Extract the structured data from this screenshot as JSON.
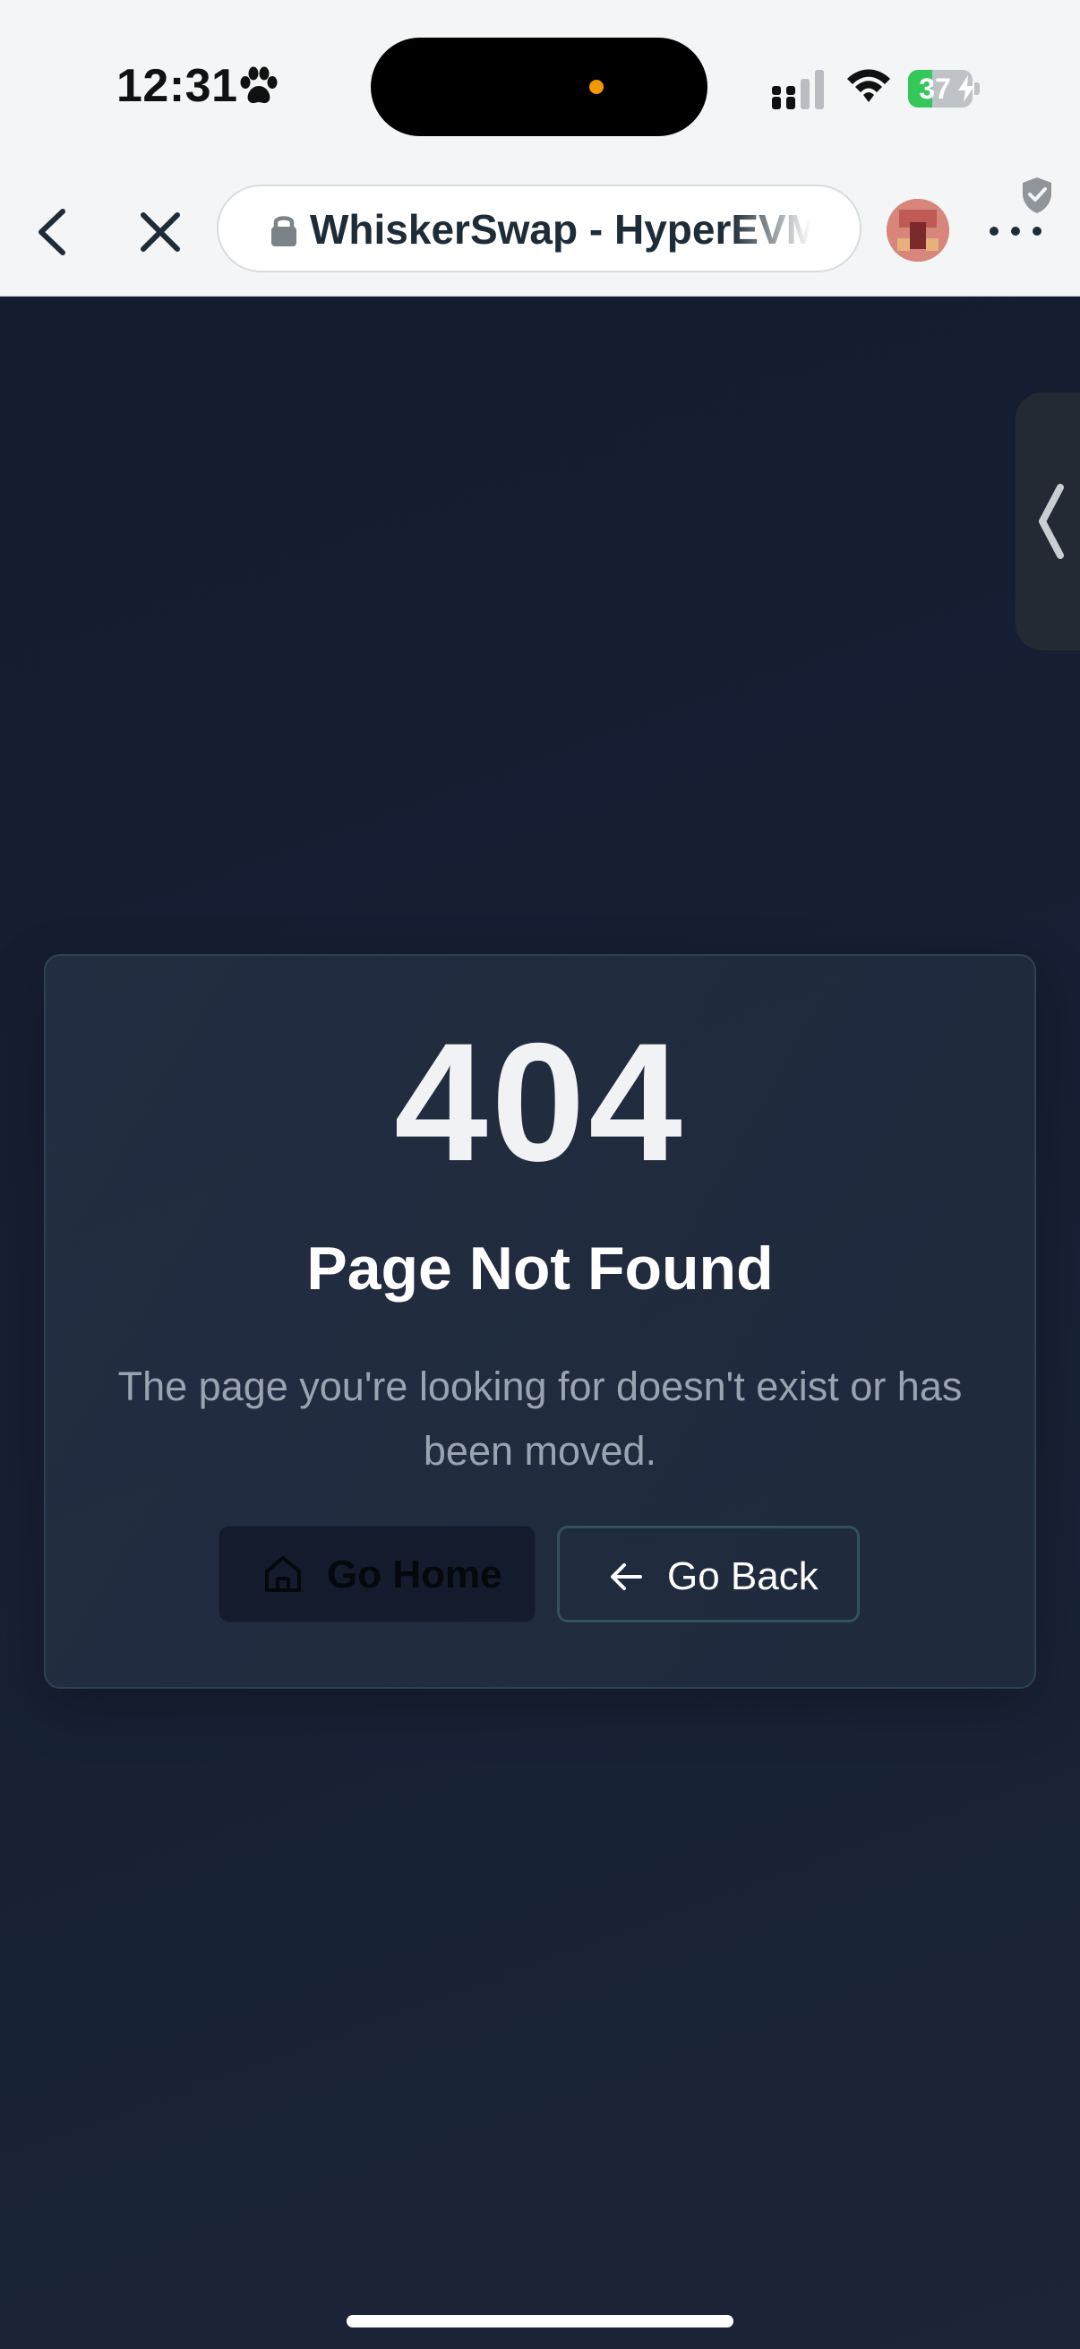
{
  "status_bar": {
    "time": "12:31",
    "battery_level": "37",
    "battery_percent": 37,
    "icons": [
      "paw-icon",
      "signal-icon",
      "wifi-icon",
      "battery-icon",
      "charging-icon"
    ]
  },
  "browser": {
    "url_title": "WhiskerSwap - HyperEVM",
    "icons": [
      "back-icon",
      "close-icon",
      "lock-icon",
      "avatar",
      "shield-icon",
      "more-icon"
    ]
  },
  "error_page": {
    "code": "404",
    "title": "Page Not Found",
    "description": "The page you're looking for doesn't exist or has been moved.",
    "home_button_label": "Go Home",
    "back_button_label": "Go Back"
  },
  "colors": {
    "page_background": "#161f33",
    "card_border": "#2e4252",
    "accent_status": "#34c759",
    "island_indicator": "#f29a00"
  }
}
